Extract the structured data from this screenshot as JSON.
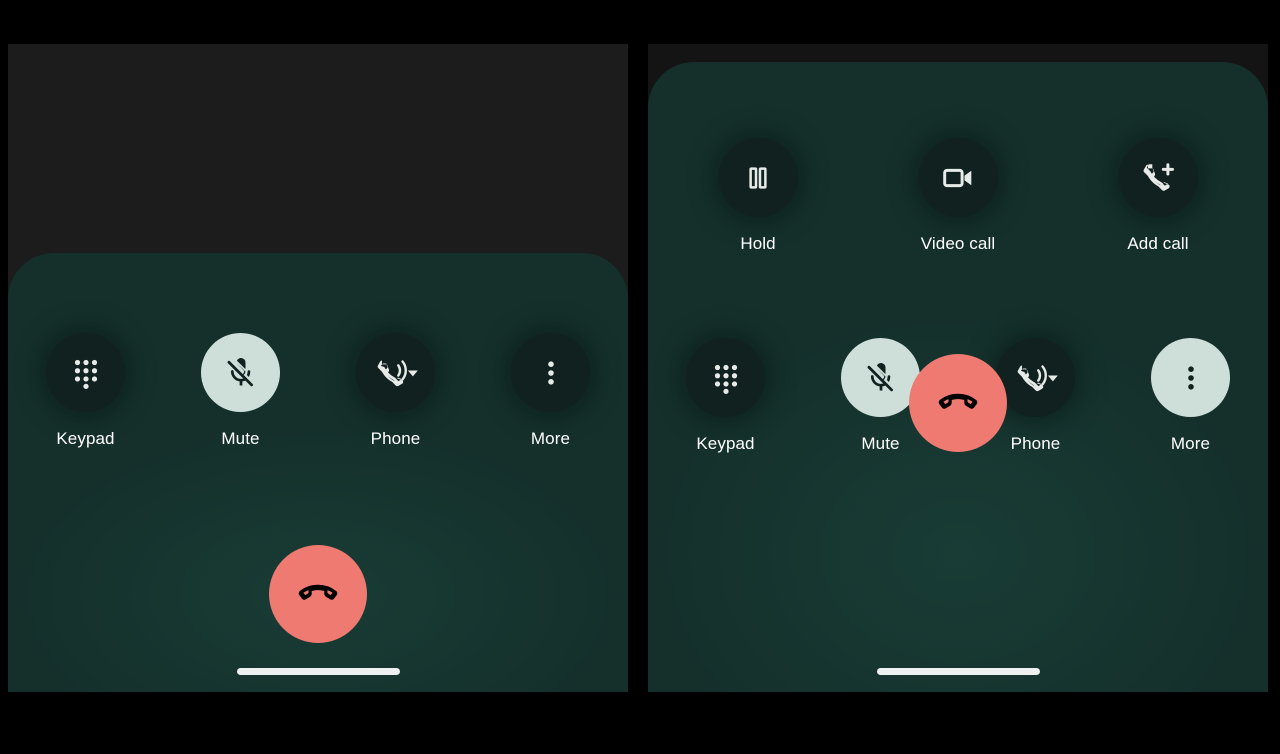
{
  "theme": {
    "page_background": "#000000",
    "panel_background": "#1b1c1b",
    "sheet_background": "#15302b",
    "button_inactive": "#11211f",
    "button_active": "#cddfd8",
    "end_call": "#ef7a71",
    "label_color": "#ffffff",
    "home_indicator": "#eef1f0"
  },
  "screens": [
    {
      "id": "collapsed",
      "name": "in-call-controls-collapsed",
      "extra_row": [],
      "main_row": [
        {
          "label": "Keypad",
          "icon": "dialpad-icon",
          "active": false
        },
        {
          "label": "Mute",
          "icon": "mic-off-icon",
          "active": true
        },
        {
          "label": "Phone",
          "icon": "phone-audio-route-icon",
          "active": false
        },
        {
          "label": "More",
          "icon": "more-vert-icon",
          "active": false
        }
      ],
      "end_call": {
        "label": "End call",
        "icon": "call-end-icon"
      },
      "home_indicator": true
    },
    {
      "id": "expanded",
      "name": "in-call-controls-expanded",
      "extra_row": [
        {
          "label": "Hold",
          "icon": "pause-icon",
          "active": false
        },
        {
          "label": "Video call",
          "icon": "videocam-icon",
          "active": false
        },
        {
          "label": "Add call",
          "icon": "add-call-icon",
          "active": false
        }
      ],
      "main_row": [
        {
          "label": "Keypad",
          "icon": "dialpad-icon",
          "active": false
        },
        {
          "label": "Mute",
          "icon": "mic-off-icon",
          "active": true
        },
        {
          "label": "Phone",
          "icon": "phone-audio-route-icon",
          "active": false
        },
        {
          "label": "More",
          "icon": "more-vert-icon",
          "active": true
        }
      ],
      "end_call": {
        "label": "End call",
        "icon": "call-end-icon"
      },
      "home_indicator": true
    }
  ]
}
